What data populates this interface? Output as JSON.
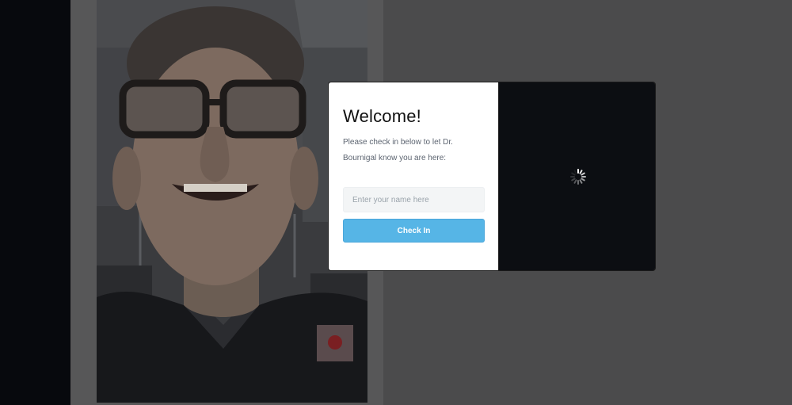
{
  "checkin": {
    "title": "Welcome!",
    "subtitle": "Please check in below to let Dr. Bournigal know you are here:",
    "name_placeholder": "Enter your name here",
    "name_value": "",
    "button_label": "Check In"
  },
  "preview": {
    "status": "loading"
  },
  "colors": {
    "accent": "#56b5e6",
    "overlay": "#4b4b4c",
    "preview_bg": "#0c0e12"
  }
}
